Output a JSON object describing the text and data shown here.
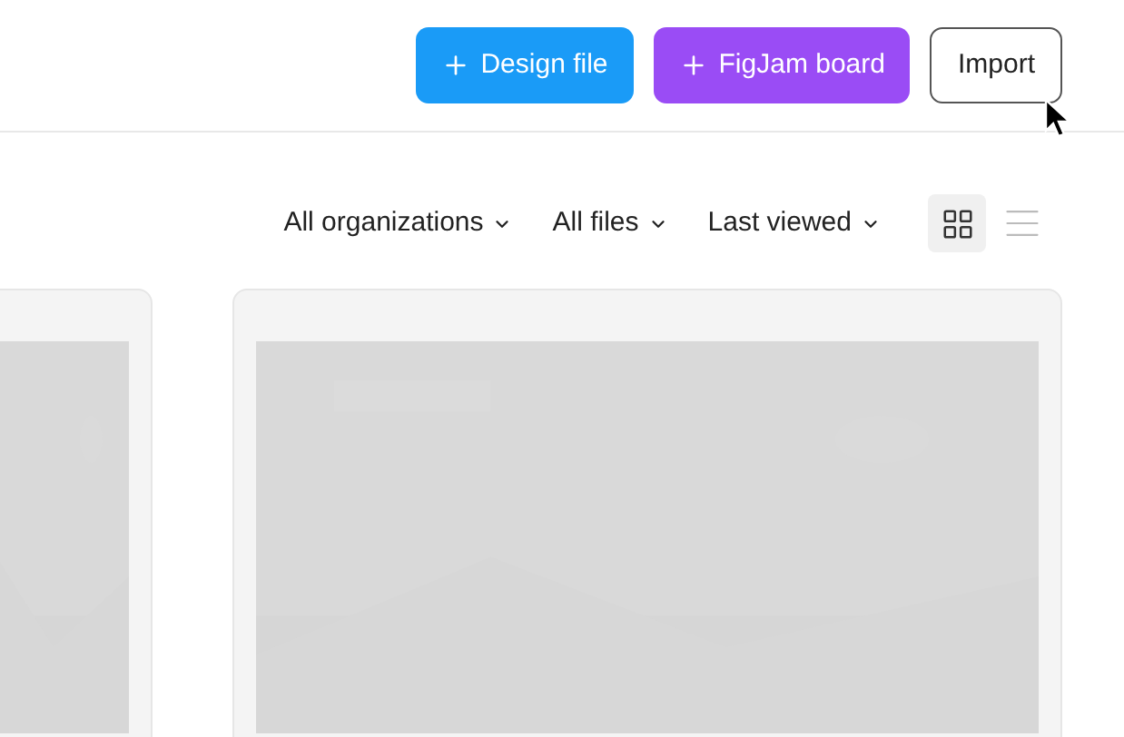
{
  "header": {
    "buttons": [
      {
        "label": "Design file",
        "kind": "design"
      },
      {
        "label": "FigJam board",
        "kind": "figjam"
      },
      {
        "label": "Import",
        "kind": "outline"
      }
    ]
  },
  "filters": [
    {
      "label": "All organizations"
    },
    {
      "label": "All files"
    },
    {
      "label": "Last viewed"
    }
  ],
  "view_options": [
    {
      "kind": "grid",
      "selected": true
    },
    {
      "kind": "list",
      "selected": false
    }
  ]
}
